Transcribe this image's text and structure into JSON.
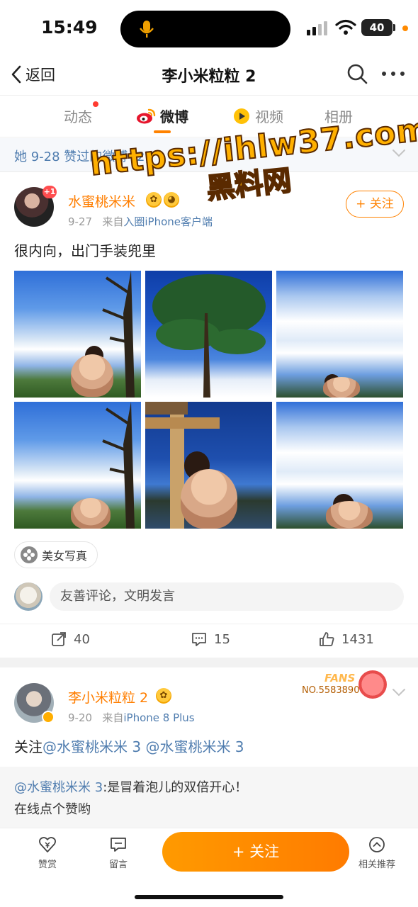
{
  "status_bar": {
    "time": "15:49",
    "battery": "40"
  },
  "nav": {
    "back_label": "返回",
    "title": "李小米粒粒 2"
  },
  "tabs": [
    {
      "label": "动态",
      "active": false,
      "has_dot": true
    },
    {
      "label": "微博",
      "active": true
    },
    {
      "label": "视频",
      "active": false
    },
    {
      "label": "相册",
      "active": false
    }
  ],
  "liked_bar": {
    "text": "她 9-28 赞过的微博 (2)"
  },
  "watermark": {
    "line1": "https://ihlw37.com",
    "line2": "黑料网"
  },
  "post1": {
    "badge": "+1",
    "username": "水蜜桃米米",
    "date": "9-27",
    "source_prefix": "来自",
    "source": "入圈iPhone客户端",
    "follow_label": "+ 关注",
    "text": "很内向，出门手装兜里",
    "tag": "美女写真",
    "comment_placeholder": "友善评论，文明发言",
    "reposts": "40",
    "comments": "15",
    "likes": "1431"
  },
  "post2": {
    "username": "李小米粒粒 2",
    "date": "9-20",
    "source_prefix": "来自",
    "source": "iPhone 8 Plus",
    "fans_word": "FANS",
    "fans_no": "NO.5583890",
    "text_prefix": "关注",
    "mention1": "@水蜜桃米米 3",
    "mention2": "@水蜜桃米米 3",
    "repost_mention": "@水蜜桃米米 3",
    "repost_text_1": ":是冒着泡儿的双倍开心！",
    "repost_text_2": "在线点个赞哟"
  },
  "bottom_bar": {
    "reward": "赞赏",
    "message": "留言",
    "follow": "+ 关注",
    "related": "相关推荐"
  },
  "colors": {
    "accent": "#ff8200",
    "link": "#507daf",
    "orange_name": "#ff7e00"
  }
}
